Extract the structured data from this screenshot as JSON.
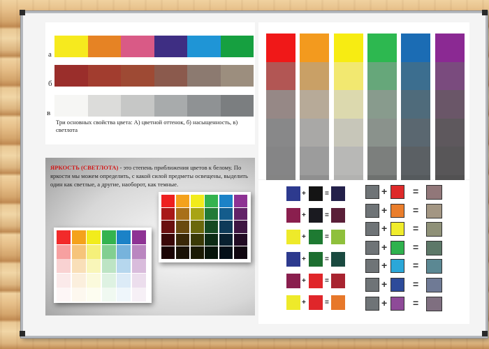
{
  "rows": {
    "a_label": "а",
    "b_label": "б",
    "v_label": "в",
    "a_colors": [
      "#f6ea1e",
      "#e68324",
      "#d95a86",
      "#3e2e83",
      "#1f95d6",
      "#16a040"
    ],
    "b_colors": [
      "#9a2e2b",
      "#a23d2f",
      "#9e4a34",
      "#8b5a4d",
      "#8c7a70",
      "#9c8e7e"
    ],
    "v_colors": [
      "#f6f6f4",
      "#dcdcda",
      "#c6c7c6",
      "#a8abac",
      "#8f9294",
      "#7b7e80"
    ]
  },
  "caption": "Три основных свойства цвета: А) цветной оттенок, б) насыщенность, в) светлота",
  "brightness": {
    "title": "ЯРКОСТЬ (СВЕТЛОТА)",
    "text": " - это степень приближения цветов к белому. По яркости мы можем определить, с какой силой предметы освещены, выделить один как светлые, а другие, наоборот, как темные."
  },
  "large_columns": [
    [
      "#f01818",
      "#b25654",
      "#968886",
      "#888889",
      "#858586",
      "#848484"
    ],
    [
      "#f39a1e",
      "#c9a066",
      "#b7aa98",
      "#a9a8a6",
      "#9c9c9c",
      "#8f8f8f"
    ],
    [
      "#f7ec12",
      "#f2e870",
      "#dcd9ae",
      "#c7c6b9",
      "#b8b8b6",
      "#b2b2b0"
    ],
    [
      "#2db850",
      "#66a77a",
      "#889b8d",
      "#8a928c",
      "#7c7f7d",
      "#6e716f"
    ],
    [
      "#1b6cb4",
      "#3c6e8f",
      "#4f6b7b",
      "#5a6770",
      "#5b6064",
      "#555a5d"
    ],
    [
      "#8b2993",
      "#7a4b7e",
      "#6a5668",
      "#5e585d",
      "#585658",
      "#525152"
    ]
  ],
  "mix_left": [
    {
      "a": "#2d3a8e",
      "op": "+",
      "b": "#141414",
      "eq": "=",
      "r": "#23204a"
    },
    {
      "a": "#8a1f4e",
      "op": "+",
      "b": "#1a1a20",
      "eq": "=",
      "r": "#5a1f38"
    },
    {
      "a": "#eeea2a",
      "op": "+",
      "b": "#1e7a32",
      "eq": "=",
      "r": "#8fc03c"
    },
    {
      "a": "#2d3a8e",
      "op": "+",
      "b": "#1d6e30",
      "eq": "=",
      "r": "#1a4a40"
    },
    {
      "a": "#8a1f4e",
      "op": "+",
      "b": "#e0262a",
      "eq": "=",
      "r": "#a82430"
    },
    {
      "a": "#eeea2a",
      "op": "+",
      "b": "#e0262a",
      "eq": "=",
      "r": "#e7782a"
    }
  ],
  "mix_right": [
    {
      "a": "#6f7477",
      "op": "+",
      "b": "#de2a2a",
      "eq": "=",
      "r": "#917779"
    },
    {
      "a": "#6f7477",
      "op": "+",
      "b": "#ea7e2c",
      "eq": "=",
      "r": "#a39683"
    },
    {
      "a": "#6f7477",
      "op": "+",
      "b": "#f0ec2c",
      "eq": "=",
      "r": "#8f9178"
    },
    {
      "a": "#6f7477",
      "op": "+",
      "b": "#2fb24e",
      "eq": "=",
      "r": "#5d7868"
    },
    {
      "a": "#6f7477",
      "op": "+",
      "b": "#2ba7d8",
      "eq": "=",
      "r": "#5b8893"
    },
    {
      "a": "#6f7477",
      "op": "+",
      "b": "#2d4b9a",
      "eq": "=",
      "r": "#6f7a95"
    },
    {
      "a": "#6f7477",
      "op": "+",
      "b": "#8e4a98",
      "eq": "=",
      "r": "#7f6f80"
    }
  ],
  "mini_light": [
    [
      "#f22a2a",
      "#f7a0a0",
      "#f9d2d2",
      "#fbeaea",
      "#fdf6f6"
    ],
    [
      "#f4a21c",
      "#f6c47a",
      "#f9dfb8",
      "#fbefdd",
      "#fdf8ef"
    ],
    [
      "#f2ec1c",
      "#f5f07a",
      "#f9f6b9",
      "#fbfadc",
      "#fdfdf0"
    ],
    [
      "#34b34f",
      "#82cf91",
      "#bde4c4",
      "#def2e2",
      "#f0f9f1"
    ],
    [
      "#1b82c7",
      "#77b3dc",
      "#b6d7ee",
      "#dcebf7",
      "#eff6fb"
    ],
    [
      "#8e3294",
      "#ba86c0",
      "#d9bcdc",
      "#ecdeed",
      "#f6f0f6"
    ]
  ],
  "mini_dark": [
    [
      "#ee2020",
      "#a81818",
      "#6a1010",
      "#3a0808",
      "#1a0404"
    ],
    [
      "#f4a21c",
      "#a8701a",
      "#6a4a10",
      "#3a2808",
      "#1a1206"
    ],
    [
      "#f2ec1c",
      "#a8a414",
      "#6a680c",
      "#3a3a06",
      "#1a1a04"
    ],
    [
      "#34b34f",
      "#227a36",
      "#164a22",
      "#0c2a14",
      "#06140a"
    ],
    [
      "#1b82c7",
      "#145c8c",
      "#0e3a58",
      "#082030",
      "#040f18"
    ],
    [
      "#8e3294",
      "#622268",
      "#3e1642",
      "#220c24",
      "#100610"
    ]
  ]
}
